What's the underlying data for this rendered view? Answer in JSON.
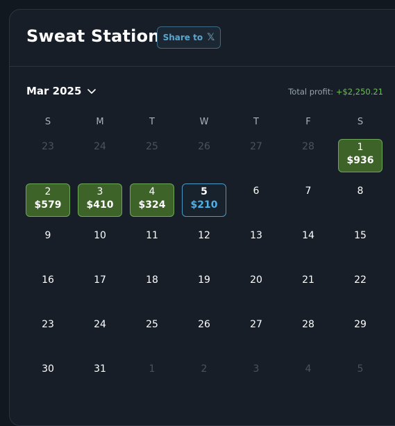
{
  "header": {
    "title": "Sweat Station",
    "share_label": "Share to",
    "share_icon": "𝕏"
  },
  "summary": {
    "month": "Mar 2025",
    "total_profit_label": "Total profit:",
    "total_profit_value": "+$2,250.21"
  },
  "calendar": {
    "weekdays": [
      "S",
      "M",
      "T",
      "W",
      "T",
      "F",
      "S"
    ],
    "weeks": [
      [
        {
          "day": "23",
          "muted": true
        },
        {
          "day": "24",
          "muted": true
        },
        {
          "day": "25",
          "muted": true
        },
        {
          "day": "26",
          "muted": true
        },
        {
          "day": "27",
          "muted": true
        },
        {
          "day": "28",
          "muted": true
        },
        {
          "day": "1",
          "value": "$936",
          "status": "profit"
        }
      ],
      [
        {
          "day": "2",
          "value": "$579",
          "status": "profit"
        },
        {
          "day": "3",
          "value": "$410",
          "status": "profit"
        },
        {
          "day": "4",
          "value": "$324",
          "status": "profit"
        },
        {
          "day": "5",
          "value": "$210",
          "status": "today"
        },
        {
          "day": "6"
        },
        {
          "day": "7"
        },
        {
          "day": "8"
        }
      ],
      [
        {
          "day": "9"
        },
        {
          "day": "10"
        },
        {
          "day": "11"
        },
        {
          "day": "12"
        },
        {
          "day": "13"
        },
        {
          "day": "14"
        },
        {
          "day": "15"
        }
      ],
      [
        {
          "day": "16"
        },
        {
          "day": "17"
        },
        {
          "day": "18"
        },
        {
          "day": "19"
        },
        {
          "day": "20"
        },
        {
          "day": "21"
        },
        {
          "day": "22"
        }
      ],
      [
        {
          "day": "23"
        },
        {
          "day": "24"
        },
        {
          "day": "25"
        },
        {
          "day": "26"
        },
        {
          "day": "27"
        },
        {
          "day": "28"
        },
        {
          "day": "29"
        }
      ],
      [
        {
          "day": "30"
        },
        {
          "day": "31"
        },
        {
          "day": "1",
          "muted": true
        },
        {
          "day": "2",
          "muted": true
        },
        {
          "day": "3",
          "muted": true
        },
        {
          "day": "4",
          "muted": true
        },
        {
          "day": "5",
          "muted": true
        }
      ]
    ]
  },
  "colors": {
    "profit_cell": "#3e6329",
    "profit_border": "#6ea85a",
    "today_border": "#4a9ac8",
    "today_value": "#4fb0e8",
    "profit_text": "#6fbf5a"
  }
}
